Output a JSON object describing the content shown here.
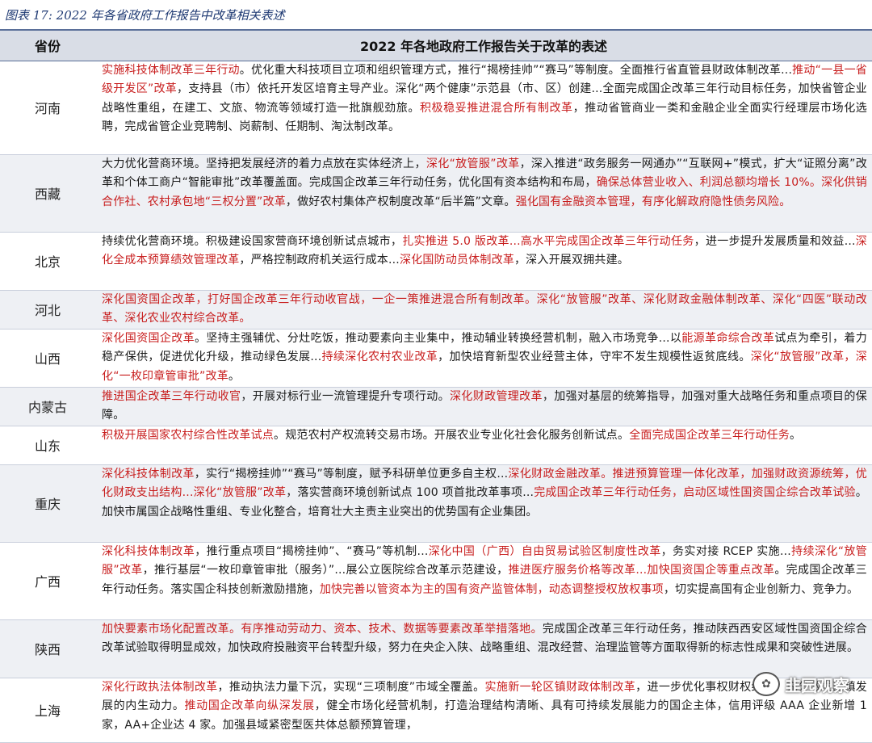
{
  "caption": "图表 17:  2022 年各省政府工作报告中改革相关表述",
  "table": {
    "header_province": "省份",
    "header_desc": "2022 年各地政府工作报告关于改革的表述",
    "rows": [
      {
        "province": "河南",
        "segments": [
          {
            "t": "实施科技体制改革三年行动",
            "red": true
          },
          {
            "t": "。优化重大科技项目立项和组织管理方式，推行“揭榜挂帅”“赛马”等制度。全面推行省直管县财政体制改革...",
            "red": false
          },
          {
            "t": "推动“一县一省级开发区”改革",
            "red": true
          },
          {
            "t": "，支持县（市）依托开发区培育主导产业。深化“两个健康”示范县（市、区）创建...全面完成国企改革三年行动目标任务，加快省管企业战略性重组，在建工、文旅、物流等领域打造一批旗舰劲旅。",
            "red": false
          },
          {
            "t": "积极稳妥推进混合所有制改革",
            "red": true
          },
          {
            "t": "，推动省管商业一类和金融企业全面实行经理层市场化选聘，完成省管企业竞聘制、岗薪制、任期制、淘汰制改革。",
            "red": false
          }
        ]
      },
      {
        "province": "西藏",
        "segments": [
          {
            "t": "大力优化营商环境。坚持把发展经济的着力点放在实体经济上，",
            "red": false
          },
          {
            "t": "深化“放管服”改革",
            "red": true
          },
          {
            "t": "，深入推进“政务服务一网通办”“互联网+”模式，扩大“证照分离”改革和个体工商户“智能审批”改革覆盖面。完成国企改革三年行动任务，优化国有资本结构和布局，",
            "red": false
          },
          {
            "t": "确保总体营业收入、利润总额均增长 10%。深化供销合作社、农村承包地“三权分置”改革",
            "red": true
          },
          {
            "t": "，做好农村集体产权制度改革“后半篇”文章。",
            "red": false
          },
          {
            "t": "强化国有金融资本管理，有序化解政府隐性债务风险。",
            "red": true
          }
        ]
      },
      {
        "province": "北京",
        "segments": [
          {
            "t": "持续优化营商环境。积极建设国家营商环境创新试点城市，",
            "red": false
          },
          {
            "t": "扎实推进 5.0 版改革...高水平完成国企改革三年行动任务",
            "red": true
          },
          {
            "t": "，进一步提升发展质量和效益...",
            "red": false
          },
          {
            "t": "深化全成本预算绩效管理改革",
            "red": true
          },
          {
            "t": "，严格控制政府机关运行成本...",
            "red": false
          },
          {
            "t": "深化国防动员体制改革",
            "red": true
          },
          {
            "t": "，深入开展双拥共建。",
            "red": false
          }
        ]
      },
      {
        "province": "河北",
        "segments": [
          {
            "t": "深化国资国企改革，打好国企改革三年行动收官战，一企一策推进混合所有制改革。深化“放管服”改革、深化财政金融体制改革、深化“四医”联动改革、深化农业农村综合改革。",
            "red": true
          }
        ]
      },
      {
        "province": "山西",
        "segments": [
          {
            "t": "深化国资国企改革",
            "red": true
          },
          {
            "t": "。坚持主强辅优、分灶吃饭，推动要素向主业集中，推动辅业转换经营机制，融入市场竞争...以",
            "red": false
          },
          {
            "t": "能源革命综合改革",
            "red": true
          },
          {
            "t": "试点为牵引，着力稳产保供，促进优化升级，推动绿色发展...",
            "red": false
          },
          {
            "t": "持续深化农村农业改革",
            "red": true
          },
          {
            "t": "，加快培育新型农业经营主体，守牢不发生规模性返贫底线。",
            "red": false
          },
          {
            "t": "深化“放管服”改革，深化“一枚印章管审批”改革",
            "red": true
          },
          {
            "t": "。",
            "red": false
          }
        ]
      },
      {
        "province": "内蒙古",
        "segments": [
          {
            "t": "推进国企改革三年行动收官",
            "red": true
          },
          {
            "t": "，开展对标行业一流管理提升专项行动。",
            "red": false
          },
          {
            "t": "深化财政管理改革",
            "red": true
          },
          {
            "t": "，加强对基层的统筹指导，加强对重大战略任务和重点项目的保障。",
            "red": false
          }
        ]
      },
      {
        "province": "山东",
        "segments": [
          {
            "t": "积极开展国家农村综合性改革试点",
            "red": true
          },
          {
            "t": "。规范农村产权流转交易市场。开展农业专业化社会化服务创新试点。",
            "red": false
          },
          {
            "t": "全面完成国企改革三年行动任务",
            "red": true
          },
          {
            "t": "。",
            "red": false
          }
        ]
      },
      {
        "province": "重庆",
        "segments": [
          {
            "t": "深化科技体制改革",
            "red": true
          },
          {
            "t": "，实行“揭榜挂帅”“赛马”等制度，赋予科研单位更多自主权...",
            "red": false
          },
          {
            "t": "深化财政金融改革。推进预算管理一体化改革，加强财政资源统筹，优化财政支出结构...深化“放管服”改革",
            "red": true
          },
          {
            "t": "，落实营商环境创新试点 100 项首批改革事项...",
            "red": false
          },
          {
            "t": "完成国企改革三年行动任务，启动区域性国资国企综合改革试验",
            "red": true
          },
          {
            "t": "。加快市属国企战略性重组、专业化整合，培育壮大主责主业突出的优势国有企业集团。",
            "red": false
          }
        ]
      },
      {
        "province": "广西",
        "segments": [
          {
            "t": "深化科技体制改革",
            "red": true
          },
          {
            "t": "，推行重点项目“揭榜挂帅”、“赛马”等机制...",
            "red": false
          },
          {
            "t": "深化中国（广西）自由贸易试验区制度性改革",
            "red": true
          },
          {
            "t": "，务实对接 RCEP 实施...",
            "red": false
          },
          {
            "t": "持续深化“放管服”改革",
            "red": true
          },
          {
            "t": "，推行基层“一枚印章管审批（服务）”...展公立医院综合改革示范建设，",
            "red": false
          },
          {
            "t": "推进医疗服务价格等改革...加快国资国企等重点改革",
            "red": true
          },
          {
            "t": "。完成国企改革三年行动任务。落实国企科技创新激励措施，",
            "red": false
          },
          {
            "t": "加快完善以管资本为主的国有资产监管体制，动态调整授权放权事项",
            "red": true
          },
          {
            "t": "，切实提高国有企业创新力、竞争力。",
            "red": false
          }
        ]
      },
      {
        "province": "陕西",
        "segments": [
          {
            "t": "加快要素市场化配置改革。有序推动劳动力、资本、技术、数据等要素改革举措落地。",
            "red": true
          },
          {
            "t": "完成国企改革三年行动任务，推动陕西西安区域性国资国企综合改革试验取得明显成效，加快政府投融资平台转型升级，努力在央企入陕、战略重组、混改经营、治理监管等方面取得新的标志性成果和突破性进展。",
            "red": false
          }
        ]
      },
      {
        "province": "上海",
        "segments": [
          {
            "t": "深化行政执法体制改革",
            "red": true
          },
          {
            "t": "，推动执法力量下沉，实现“三项制度”市域全覆盖。",
            "red": false
          },
          {
            "t": "实施新一轮区镇财政体制改革",
            "red": true
          },
          {
            "t": "，进一步优化事权财权结构，充分激发区镇发展的内生动力。",
            "red": false
          },
          {
            "t": "推动国企改革向纵深发展",
            "red": true
          },
          {
            "t": "，健全市场化经营机制，打造治理结构清晰、具有可持续发展能力的国企主体，信用评级 AAA 企业新增 1 家，AA+企业达 4 家。加强县域紧密型医共体总额预算管理，",
            "red": false
          }
        ]
      }
    ]
  },
  "watermark": "韭园观察"
}
